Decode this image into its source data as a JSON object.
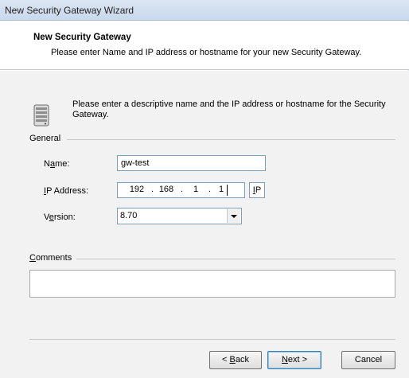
{
  "window": {
    "title": "New Security Gateway Wizard"
  },
  "header": {
    "title": "New Security Gateway",
    "subtitle": "Please enter Name and IP address or hostname for your new Security Gateway."
  },
  "intro": {
    "icon": "server-icon",
    "text": "Please enter a descriptive name and the IP address or hostname for the Security Gateway."
  },
  "general": {
    "group_label": "General",
    "name_label": {
      "pre": "N",
      "key": "a",
      "post": "me:"
    },
    "name_value": "gw-test",
    "ip_label": {
      "pre": "",
      "key": "I",
      "post": "P Address:"
    },
    "ip_octets": [
      "192",
      "168",
      "1",
      "1"
    ],
    "ip_dot": ".",
    "ip_toggle": {
      "key": "I",
      "post": "P"
    },
    "version_label": {
      "pre": "V",
      "key": "e",
      "post": "rsion:"
    },
    "version_value": "8.70"
  },
  "comments": {
    "label": {
      "key": "C",
      "post": "omments"
    },
    "value": ""
  },
  "buttons": {
    "back": {
      "pre": "< ",
      "key": "B",
      "post": "ack"
    },
    "next": {
      "key": "N",
      "post": "ext >"
    },
    "cancel": "Cancel"
  }
}
